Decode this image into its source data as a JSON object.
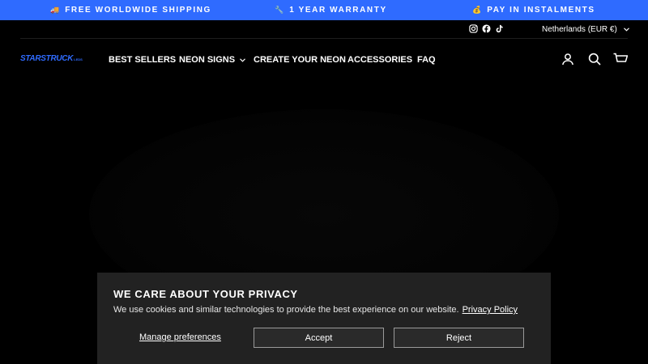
{
  "announcement": {
    "items": [
      {
        "emoji": "🚚",
        "text": "FREE WORLDWIDE SHIPPING"
      },
      {
        "emoji": "🔧",
        "text": "1 YEAR WARRANTY"
      },
      {
        "emoji": "💰",
        "text": "PAY IN INSTALMENTS"
      }
    ]
  },
  "social": [
    "instagram-icon",
    "facebook-icon",
    "tiktok-icon"
  ],
  "region": {
    "label": "Netherlands (EUR €)"
  },
  "logo": {
    "main": "STARSTRUCK",
    "sub": "LEDS"
  },
  "nav": {
    "items": [
      {
        "label": "BEST SELLERS"
      },
      {
        "label": "NEON SIGNS"
      },
      {
        "label": "CREATE YOUR NEON"
      },
      {
        "label": "ACCESSORIES"
      },
      {
        "label": "FAQ"
      }
    ]
  },
  "header_icons": [
    "account-icon",
    "search-icon",
    "cart-icon"
  ],
  "cookie": {
    "title": "WE CARE ABOUT YOUR PRIVACY",
    "body": "We use cookies and similar technologies to provide the best experience on our website.",
    "link": "Privacy Policy",
    "manage": "Manage preferences",
    "accept": "Accept",
    "reject": "Reject"
  },
  "colors": {
    "accent": "#2f6bff",
    "background": "#000000",
    "banner": "#222222"
  }
}
